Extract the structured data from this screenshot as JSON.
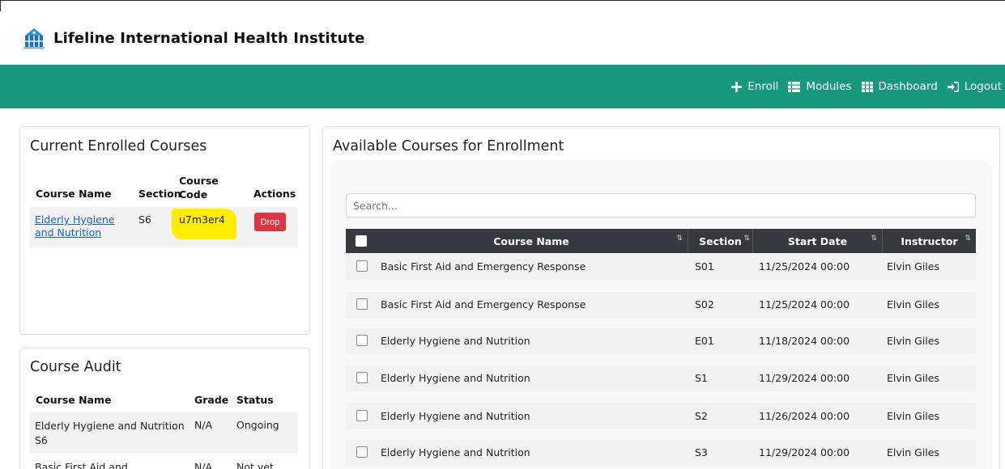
{
  "app": {
    "title": "Lifeline International Health Institute"
  },
  "nav": {
    "items": [
      {
        "label": "Enroll",
        "icon": "plus-icon"
      },
      {
        "label": "Modules",
        "icon": "list-icon"
      },
      {
        "label": "Dashboard",
        "icon": "grid-icon"
      },
      {
        "label": "Logout",
        "icon": "sign-in-icon"
      }
    ]
  },
  "enrolled": {
    "title": "Current Enrolled Courses",
    "headers": {
      "course_name": "Course Name",
      "section": "Section",
      "course_code": "Course Code",
      "actions": "Actions"
    },
    "rows": [
      {
        "course_name": "Elderly Hygiene and Nutrition",
        "section": "S6",
        "course_code": "u7m3er4",
        "action": "Drop"
      }
    ]
  },
  "audit": {
    "title": "Course Audit",
    "headers": {
      "course_name": "Course Name",
      "grade": "Grade",
      "status": "Status"
    },
    "rows": [
      {
        "course_name": "Elderly Hygiene and Nutrition S6",
        "grade": "N/A",
        "status": "Ongoing"
      },
      {
        "course_name": "Basic First Aid and",
        "grade": "N/A",
        "status": "Not yet"
      }
    ]
  },
  "available": {
    "title": "Available Courses for Enrollment",
    "search_placeholder": "Search...",
    "headers": {
      "course_name": "Course Name",
      "section": "Section",
      "start_date": "Start Date",
      "instructor": "Instructor"
    },
    "rows": [
      {
        "course_name": "Basic First Aid and Emergency Response",
        "section": "S01",
        "start_date": "11/25/2024 00:00",
        "instructor": "Elvin Giles"
      },
      {
        "course_name": "Basic First Aid and Emergency Response",
        "section": "S02",
        "start_date": "11/25/2024 00:00",
        "instructor": "Elvin Giles"
      },
      {
        "course_name": "Elderly Hygiene and Nutrition",
        "section": "E01",
        "start_date": "11/18/2024 00:00",
        "instructor": "Elvin Giles"
      },
      {
        "course_name": "Elderly Hygiene and Nutrition",
        "section": "S1",
        "start_date": "11/29/2024 00:00",
        "instructor": "Elvin Giles"
      },
      {
        "course_name": "Elderly Hygiene and Nutrition",
        "section": "S2",
        "start_date": "11/26/2024 00:00",
        "instructor": "Elvin Giles"
      },
      {
        "course_name": "Elderly Hygiene and Nutrition",
        "section": "S3",
        "start_date": "11/29/2024 00:00",
        "instructor": "Elvin Giles"
      }
    ]
  },
  "colors": {
    "navbar": "#17987d",
    "drop_button": "#dc3545",
    "highlight": "#ffee00",
    "table_header": "#343a40",
    "link": "#1a5fd4"
  }
}
